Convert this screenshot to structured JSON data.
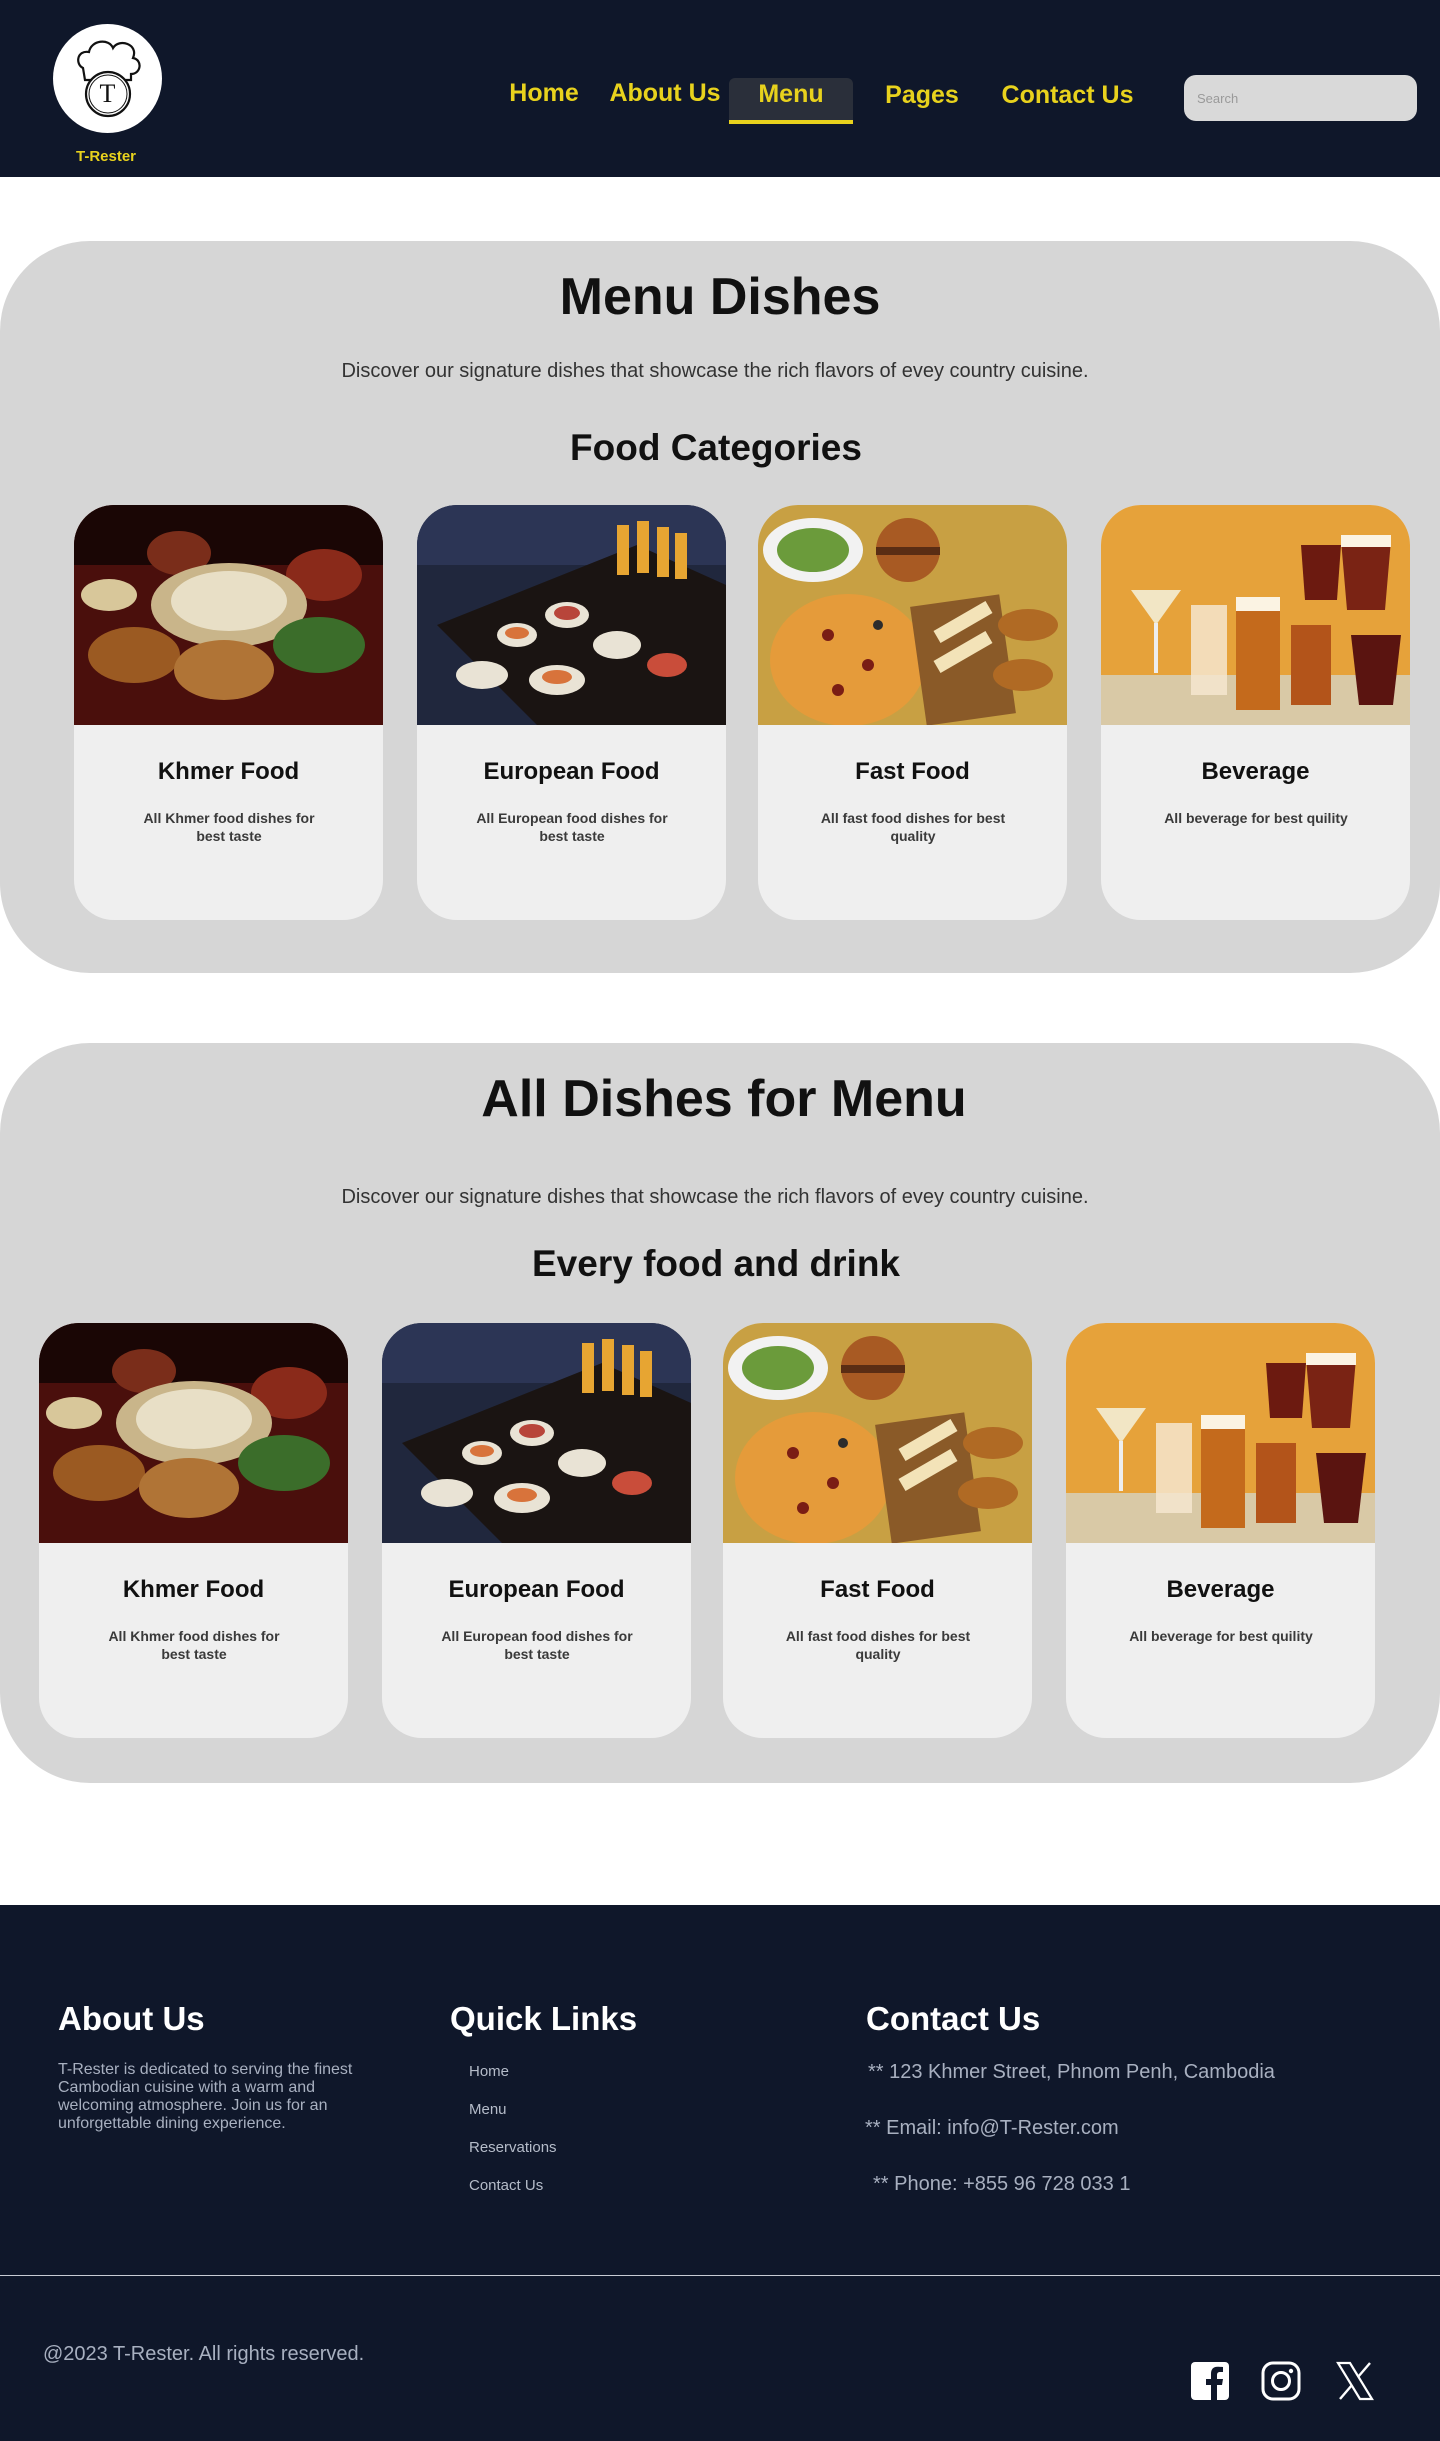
{
  "header": {
    "brand": "T-Rester",
    "logo_letter": "T",
    "nav": [
      "Home",
      "About Us",
      "Menu",
      "Pages",
      "Contact Us"
    ],
    "active_nav": "Menu",
    "search_placeholder": "Search"
  },
  "section1": {
    "title": "Menu Dishes",
    "description": "Discover our signature dishes that showcase the rich flavors of evey country cuisine.",
    "subtitle": "Food Categories",
    "cards": [
      {
        "name": "Khmer Food",
        "desc": "All Khmer food dishes for best taste",
        "image": "khmer-food-photo"
      },
      {
        "name": "European Food",
        "desc": "All European food dishes for best taste",
        "image": "european-food-photo"
      },
      {
        "name": "Fast Food",
        "desc": "All fast food dishes for best quality",
        "image": "fast-food-photo"
      },
      {
        "name": "Beverage",
        "desc": "All beverage for best quility",
        "image": "beverage-photo"
      }
    ]
  },
  "section2": {
    "title": "All Dishes for Menu",
    "description": "Discover our signature dishes that showcase the rich flavors of evey country cuisine.",
    "subtitle": "Every food and drink",
    "cards": [
      {
        "name": "Khmer Food",
        "desc": "All Khmer food dishes for best taste",
        "image": "khmer-food-photo"
      },
      {
        "name": "European Food",
        "desc": "All European food dishes for best taste",
        "image": "european-food-photo"
      },
      {
        "name": "Fast Food",
        "desc": "All fast food dishes for best quality",
        "image": "fast-food-photo"
      },
      {
        "name": "Beverage",
        "desc": "All beverage for best quility",
        "image": "beverage-photo"
      }
    ]
  },
  "footer": {
    "about_title": "About Us",
    "about_text": "T-Rester is dedicated to serving the finest Cambodian cuisine with a warm and welcoming atmosphere. Join us for an unforgettable dining experience.",
    "links_title": "Quick Links",
    "links": [
      "Home",
      "Menu",
      "Reservations",
      "Contact Us"
    ],
    "contact_title": "Contact Us",
    "address": "** 123 Khmer Street, Phnom Penh, Cambodia",
    "email": "** Email: info@T-Rester.com",
    "phone": "** Phone: +855 96 728 033 1",
    "copyright": "@2023 T-Rester. All rights reserved.",
    "social": [
      "facebook-icon",
      "instagram-icon",
      "x-icon"
    ]
  },
  "colors": {
    "navy": "#0f172a",
    "accent_yellow": "#e8d21d",
    "section_gray": "#d6d6d6",
    "card_gray": "#efefef"
  }
}
